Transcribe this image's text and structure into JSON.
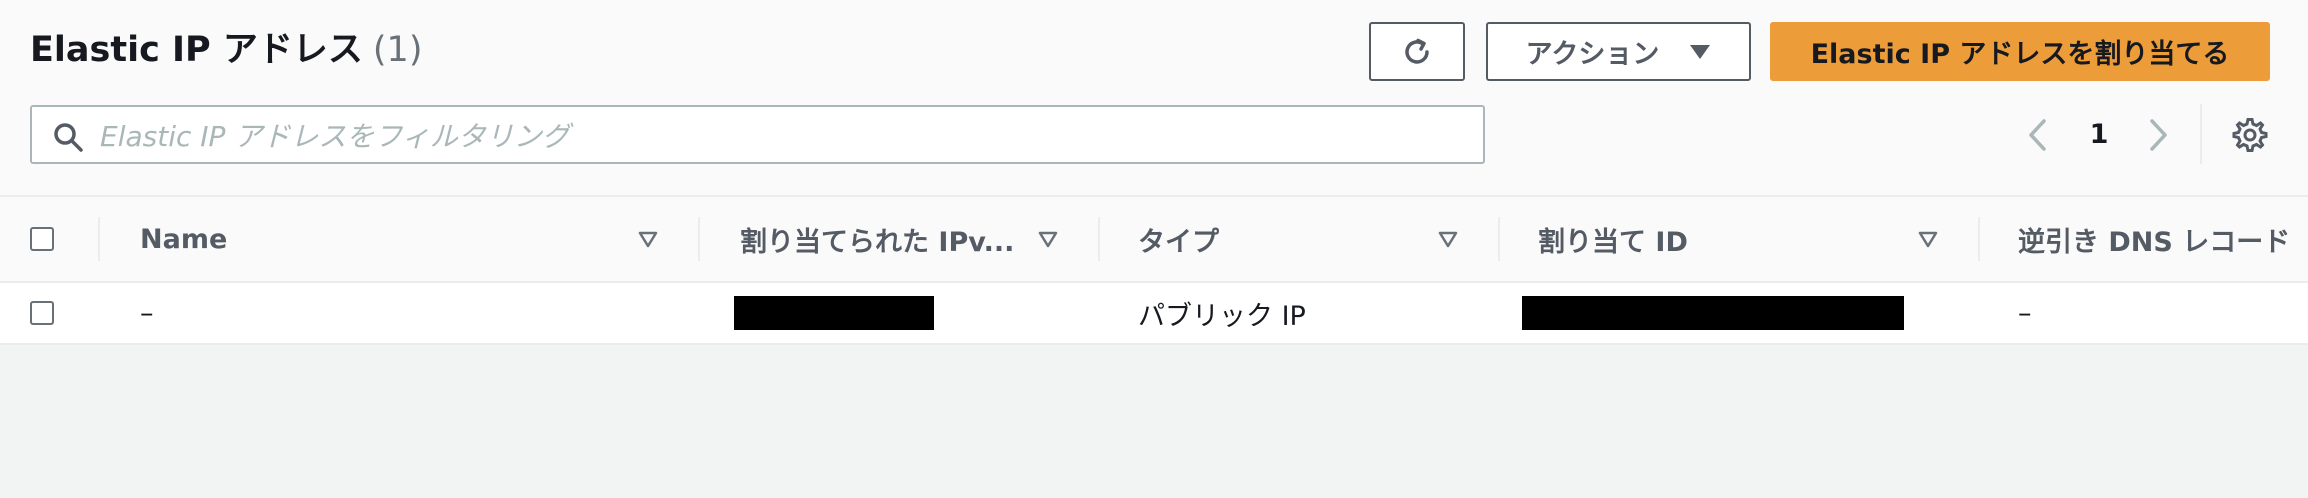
{
  "header": {
    "title": "Elastic IP アドレス",
    "count": "(1)",
    "actions_label": "アクション",
    "allocate_label": "Elastic IP アドレスを割り当てる"
  },
  "search": {
    "placeholder": "Elastic IP アドレスをフィルタリング"
  },
  "pagination": {
    "current_page": "1"
  },
  "table": {
    "columns": [
      "Name",
      "割り当てられた IPv...",
      "タイプ",
      "割り当て ID",
      "逆引き DNS レコード"
    ],
    "rows": [
      {
        "name": "–",
        "ipv4": "[redacted]",
        "type": "パブリック IP",
        "allocation_id": "[redacted]",
        "reverse_dns": "–"
      }
    ]
  },
  "colors": {
    "primary_button": "#ec9c39",
    "border": "#545b64",
    "muted_text": "#687078",
    "background": "#f2f3f3",
    "redaction": "#000000"
  },
  "icons": {
    "refresh": "refresh-icon",
    "dropdown": "caret-down-icon",
    "search": "search-icon",
    "prev": "chevron-left-icon",
    "next": "chevron-right-icon",
    "settings": "gear-icon",
    "sort": "sort-caret-icon"
  }
}
